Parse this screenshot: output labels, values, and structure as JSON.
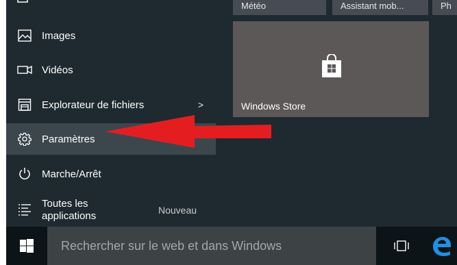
{
  "menu": {
    "items": [
      {
        "label": "Images",
        "icon": "images-icon"
      },
      {
        "label": "Vidéos",
        "icon": "videos-icon"
      },
      {
        "label": "Explorateur de fichiers",
        "icon": "file-explorer-icon",
        "chevron": ">"
      },
      {
        "label": "Paramètres",
        "icon": "gear-icon"
      },
      {
        "label": "Marche/Arrêt",
        "icon": "power-icon"
      }
    ],
    "all_apps": {
      "line1": "Toutes les",
      "line2": "applications",
      "badge": "Nouveau"
    }
  },
  "tiles": {
    "top_row": [
      "Météo",
      "Assistant mob...",
      "Ph"
    ],
    "store": {
      "label": "Windows Store"
    }
  },
  "taskbar": {
    "search_placeholder": "Rechercher sur le web et dans Windows"
  },
  "colors": {
    "menu_bg": "#1f2a30",
    "highlight_bg": "#3c474d",
    "tile_bg": "#5c5858",
    "taskbar_bg": "#0d1417",
    "search_bg": "#3d4244",
    "edge_blue": "#1e8fe8",
    "arrow_red": "#e41e20"
  }
}
